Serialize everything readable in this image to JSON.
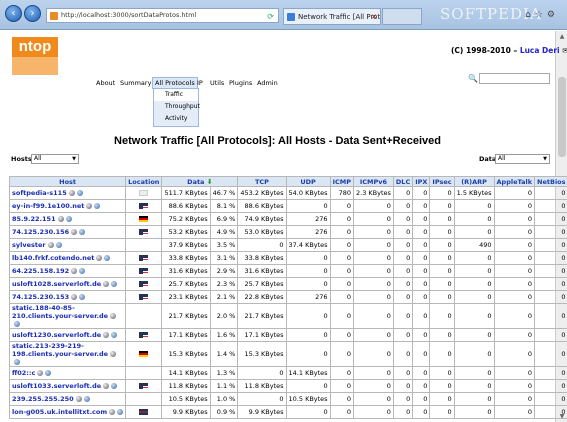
{
  "browser": {
    "address": "http://localhost:3000/sortDataProtos.html",
    "tabs": [
      {
        "label": "Network Traffic [All Protocols]"
      },
      {
        "label": ""
      }
    ],
    "watermark": "SOFTPEDIA"
  },
  "header": {
    "logo_text": "ntop",
    "copyright_prefix": "(C) 1998-2010 – ",
    "copyright_author": "Luca Deri"
  },
  "menu": {
    "items": [
      "About",
      "Summary",
      "All Protocols",
      "IP",
      "Utils",
      "Plugins",
      "Admin"
    ],
    "dropdown": [
      "Traffic",
      "Throughput",
      "Activity"
    ]
  },
  "page": {
    "title": "Network Traffic [All Protocols]: All Hosts - Data Sent+Received",
    "hosts_label": "Hosts",
    "hosts_value": "All",
    "data_label": "Data",
    "data_value": "All"
  },
  "table": {
    "headers": [
      "Host",
      "Location",
      "Data",
      "",
      "TCP",
      "UDP",
      "ICMP",
      "ICMPv6",
      "DLC",
      "IPX",
      "IPsec",
      "(R)ARP",
      "AppleTalk",
      "NetBios"
    ],
    "rows": [
      {
        "host": "softpedia-s115",
        "flag": "loc",
        "cells": [
          "511.7 KBytes",
          "46.7 %",
          "453.2 KBytes",
          "54.0 KBytes",
          "780",
          "2.3 KBytes",
          "0",
          "0",
          "0",
          "1.5 KBytes",
          "0",
          "0"
        ]
      },
      {
        "host": "ey-in-f99.1e100.net",
        "flag": "us",
        "cells": [
          "88.6 KBytes",
          "8.1 %",
          "88.6 KBytes",
          "0",
          "0",
          "0",
          "0",
          "0",
          "0",
          "0",
          "0",
          "0"
        ]
      },
      {
        "host": "85.9.22.151",
        "flag": "de",
        "cells": [
          "75.2 KBytes",
          "6.9 %",
          "74.9 KBytes",
          "276",
          "0",
          "0",
          "0",
          "0",
          "0",
          "0",
          "0",
          "0"
        ]
      },
      {
        "host": "74.125.230.156",
        "flag": "us",
        "cells": [
          "53.2 KBytes",
          "4.9 %",
          "53.0 KBytes",
          "276",
          "0",
          "0",
          "0",
          "0",
          "0",
          "0",
          "0",
          "0"
        ]
      },
      {
        "host": "sylvester",
        "flag": "",
        "cells": [
          "37.9 KBytes",
          "3.5 %",
          "0",
          "37.4 KBytes",
          "0",
          "0",
          "0",
          "0",
          "0",
          "490",
          "0",
          "0"
        ]
      },
      {
        "host": "lb140.frkf.cotendo.net",
        "flag": "us",
        "cells": [
          "33.8 KBytes",
          "3.1 %",
          "33.8 KBytes",
          "0",
          "0",
          "0",
          "0",
          "0",
          "0",
          "0",
          "0",
          "0"
        ]
      },
      {
        "host": "64.225.158.192",
        "flag": "us",
        "cells": [
          "31.6 KBytes",
          "2.9 %",
          "31.6 KBytes",
          "0",
          "0",
          "0",
          "0",
          "0",
          "0",
          "0",
          "0",
          "0"
        ]
      },
      {
        "host": "usloft1028.serverloft.de",
        "flag": "us",
        "cells": [
          "25.7 KBytes",
          "2.3 %",
          "25.7 KBytes",
          "0",
          "0",
          "0",
          "0",
          "0",
          "0",
          "0",
          "0",
          "0"
        ]
      },
      {
        "host": "74.125.230.153",
        "flag": "us",
        "cells": [
          "23.1 KBytes",
          "2.1 %",
          "22.8 KBytes",
          "276",
          "0",
          "0",
          "0",
          "0",
          "0",
          "0",
          "0",
          "0"
        ]
      },
      {
        "host": "static.188-40-85-210.clients.your-server.de",
        "flag": "",
        "tall": true,
        "cells": [
          "21.7 KBytes",
          "2.0 %",
          "21.7 KBytes",
          "0",
          "0",
          "0",
          "0",
          "0",
          "0",
          "0",
          "0",
          "0"
        ]
      },
      {
        "host": "usloft1230.serverloft.de",
        "flag": "us",
        "cells": [
          "17.1 KBytes",
          "1.6 %",
          "17.1 KBytes",
          "0",
          "0",
          "0",
          "0",
          "0",
          "0",
          "0",
          "0",
          "0"
        ]
      },
      {
        "host": "static.213-239-219-198.clients.your-server.de",
        "flag": "de",
        "tall": true,
        "cells": [
          "15.3 KBytes",
          "1.4 %",
          "15.3 KBytes",
          "0",
          "0",
          "0",
          "0",
          "0",
          "0",
          "0",
          "0",
          "0"
        ]
      },
      {
        "host": "ff02::c",
        "flag": "",
        "cells": [
          "14.1 KBytes",
          "1.3 %",
          "0",
          "14.1 KBytes",
          "0",
          "0",
          "0",
          "0",
          "0",
          "0",
          "0",
          "0"
        ]
      },
      {
        "host": "usloft1033.serverloft.de",
        "flag": "us",
        "cells": [
          "11.8 KBytes",
          "1.1 %",
          "11.8 KBytes",
          "0",
          "0",
          "0",
          "0",
          "0",
          "0",
          "0",
          "0",
          "0"
        ]
      },
      {
        "host": "239.255.255.250",
        "flag": "",
        "cells": [
          "10.5 KBytes",
          "1.0 %",
          "0",
          "10.5 KBytes",
          "0",
          "0",
          "0",
          "0",
          "0",
          "0",
          "0",
          "0"
        ]
      },
      {
        "host": "lon-g005.uk.intellitxt.com",
        "flag": "gb",
        "cells": [
          "9.9 KBytes",
          "0.9 %",
          "9.9 KBytes",
          "0",
          "0",
          "0",
          "0",
          "0",
          "0",
          "0",
          "0",
          "0"
        ]
      }
    ]
  }
}
